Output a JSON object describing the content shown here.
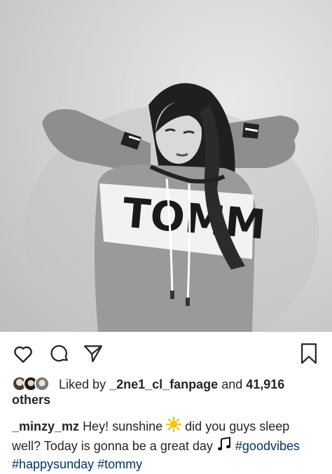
{
  "post": {
    "liked_by_prefix": "Liked by",
    "liked_by_user": "_2ne1_cl_fanpage",
    "and_text": "and",
    "likes_count": "41,916",
    "others_text": "others",
    "caption": {
      "username": "_minzy_mz",
      "text_part1": "Hey! sunshine",
      "sun_emoji_icon": "sun-emoji",
      "text_part2": "did you guys sleep well? Today is gonna be a great day",
      "music_emoji_icon": "music-notes-emoji",
      "hashtags": [
        "#goodvibes",
        "#happysunday",
        "#tommy"
      ]
    },
    "photo": {
      "shirt_text": "TOMM"
    }
  },
  "actions": {
    "icons": [
      "heart-icon",
      "comment-icon",
      "share-icon",
      "bookmark-icon"
    ]
  },
  "colors": {
    "text": "#262626",
    "hashtag": "#003569",
    "background": "#ffffff"
  }
}
